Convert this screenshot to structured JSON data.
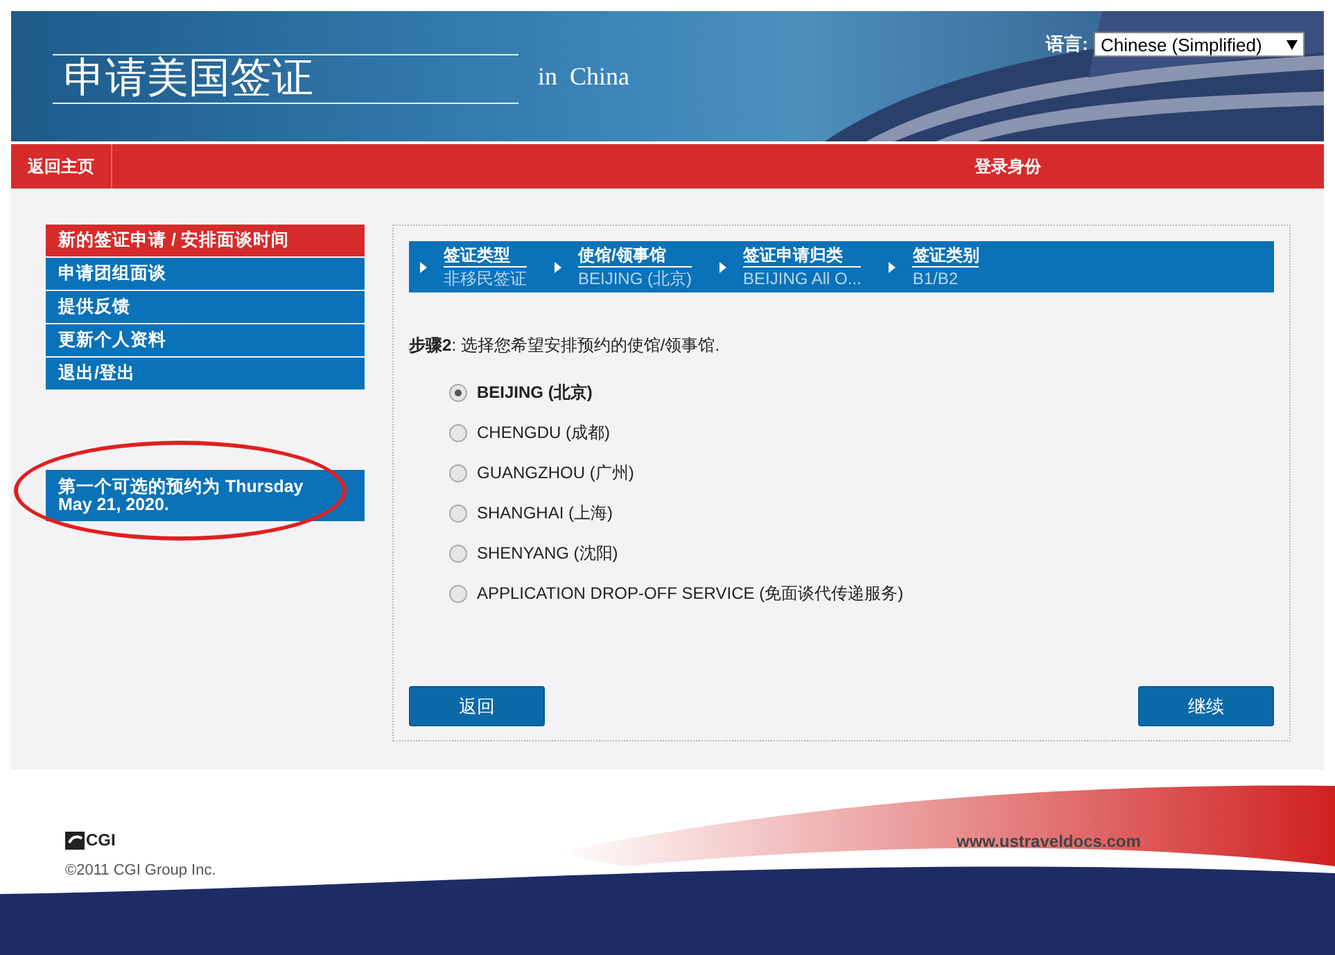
{
  "header": {
    "title": "申请美国签证",
    "subtitle": "in  China",
    "language_label": "语言:",
    "language_value": "Chinese (Simplified)"
  },
  "nav": {
    "home": "返回主页",
    "login": "登录身份"
  },
  "sidebar": {
    "items": [
      {
        "label": "新的签证申请 / 安排面谈时间",
        "selected": true
      },
      {
        "label": "申请团组面谈",
        "selected": false
      },
      {
        "label": "提供反馈",
        "selected": false
      },
      {
        "label": "更新个人资料",
        "selected": false
      },
      {
        "label": "退出/登出",
        "selected": false
      }
    ],
    "notice": "第一个可选的预约为 Thursday May 21, 2020."
  },
  "breadcrumb": [
    {
      "label": "签证类型",
      "value": "非移民签证"
    },
    {
      "label": "使馆/领事馆",
      "value": "BEIJING (北京)"
    },
    {
      "label": "签证申请归类",
      "value": "BEIJING All O..."
    },
    {
      "label": "签证类别",
      "value": "B1/B2"
    }
  ],
  "step_text": "**步骤2**: 选择您希望安排预约的使馆/领事馆.",
  "options": [
    {
      "label": "BEIJING (北京)",
      "selected": true
    },
    {
      "label": "CHENGDU (成都)",
      "selected": false
    },
    {
      "label": "GUANGZHOU (广州)",
      "selected": false
    },
    {
      "label": "SHANGHAI (上海)",
      "selected": false
    },
    {
      "label": "SHENYANG (沈阳)",
      "selected": false
    },
    {
      "label": "APPLICATION DROP-OFF SERVICE (免面谈代传递服务)",
      "selected": false
    }
  ],
  "buttons": {
    "back": "返回",
    "continue": "继续"
  },
  "footer": {
    "logo": "CGI",
    "url": "www.ustraveldocs.com",
    "copyright": "©2011 CGI Group Inc."
  }
}
